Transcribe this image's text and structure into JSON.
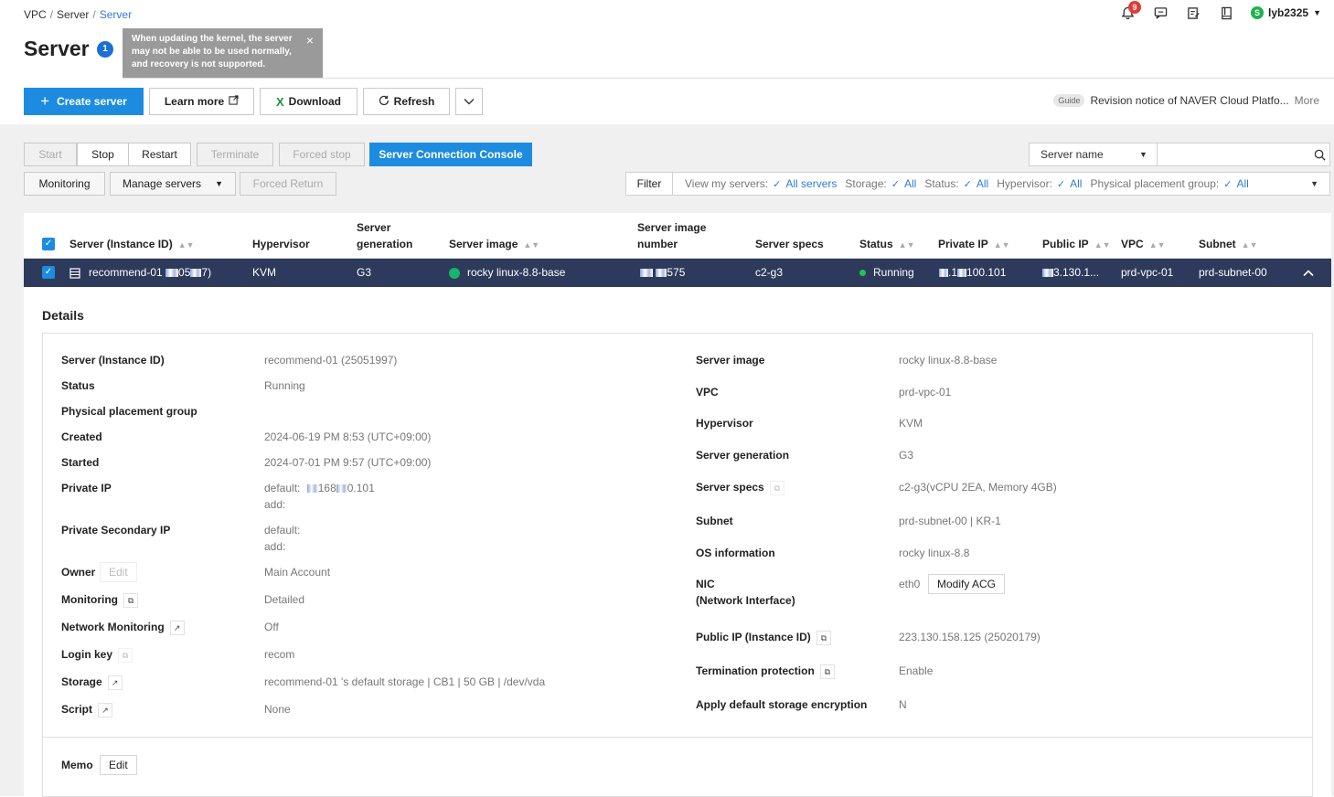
{
  "breadcrumb": {
    "items": [
      "VPC",
      "Server"
    ],
    "current": "Server"
  },
  "page": {
    "title": "Server",
    "info_badge": "1"
  },
  "tooltip": {
    "text": "When updating the kernel, the server may not be able to be used normally, and recovery is not supported.",
    "close": "×"
  },
  "header": {
    "notification_count": "9",
    "user": "lyb2325",
    "user_initial": "S"
  },
  "toolbar": {
    "create": "Create server",
    "learn": "Learn more",
    "download": "Download",
    "refresh": "Refresh"
  },
  "guide": {
    "tag": "Guide",
    "text": "Revision notice of NAVER Cloud Platfo...",
    "more": "More"
  },
  "actions": {
    "start": "Start",
    "stop": "Stop",
    "restart": "Restart",
    "terminate": "Terminate",
    "forced_stop": "Forced stop",
    "console": "Server Connection Console",
    "monitoring": "Monitoring",
    "manage": "Manage servers",
    "forced_return": "Forced Return"
  },
  "search": {
    "field": "Server name",
    "placeholder": ""
  },
  "filter": {
    "label": "Filter",
    "items": [
      {
        "label": "View my servers:",
        "value": "All servers"
      },
      {
        "label": "Storage:",
        "value": "All"
      },
      {
        "label": "Status:",
        "value": "All"
      },
      {
        "label": "Hypervisor:",
        "value": "All"
      },
      {
        "label": "Physical placement group:",
        "value": "All"
      }
    ]
  },
  "table": {
    "headers": {
      "server": "Server (Instance ID)",
      "hypervisor": "Hypervisor",
      "generation_1": "Server",
      "generation_2": "generation",
      "image": "Server image",
      "image_number_1": "Server image",
      "image_number_2": "number",
      "specs": "Server specs",
      "status": "Status",
      "private_ip": "Private IP",
      "public_ip": "Public IP",
      "vpc": "VPC",
      "subnet": "Subnet"
    },
    "row": {
      "server_prefix": "recommend-01",
      "server_mid": "05",
      "server_suffix": "7)",
      "hypervisor": "KVM",
      "generation": "G3",
      "image": "rocky linux-8.8-base",
      "image_number_suffix": "575",
      "specs": "c2-g3",
      "status": "Running",
      "private_ip_mid": ".1",
      "private_ip_suffix": "100.101",
      "public_ip_suffix": "3.130.1...",
      "vpc": "prd-vpc-01",
      "subnet": "prd-subnet-00"
    }
  },
  "details": {
    "title": "Details",
    "left": {
      "server_label": "Server (Instance ID)",
      "server_value": "recommend-01 (25051997)",
      "status_label": "Status",
      "status_value": "Running",
      "ppg_label": "Physical placement group",
      "created_label": "Created",
      "created_value": "2024-06-19 PM 8:53 (UTC+09:00)",
      "started_label": "Started",
      "started_value": "2024-07-01 PM 9:57 (UTC+09:00)",
      "private_ip_label": "Private IP",
      "private_ip_default": "default:",
      "private_ip_value_a": "168",
      "private_ip_value_b": "0.101",
      "private_ip_add": "add:",
      "secondary_label": "Private Secondary IP",
      "secondary_default": "default:",
      "secondary_add": "add:",
      "owner_label": "Owner",
      "owner_edit": "Edit",
      "owner_value": "Main Account",
      "monitoring_label": "Monitoring",
      "monitoring_value": "Detailed",
      "netmon_label": "Network Monitoring",
      "netmon_value": "Off",
      "loginkey_label": "Login key",
      "loginkey_value": "recom",
      "storage_label": "Storage",
      "storage_value": "recommend-01 's default storage | CB1 | 50 GB | /dev/vda",
      "script_label": "Script",
      "script_value": "None"
    },
    "right": {
      "image_label": "Server image",
      "image_value": "rocky linux-8.8-base",
      "vpc_label": "VPC",
      "vpc_value": "prd-vpc-01",
      "hypervisor_label": "Hypervisor",
      "hypervisor_value": "KVM",
      "generation_label": "Server generation",
      "generation_value": "G3",
      "specs_label": "Server specs",
      "specs_value": "c2-g3(vCPU 2EA, Memory 4GB)",
      "subnet_label": "Subnet",
      "subnet_value": "prd-subnet-00 | KR-1",
      "os_label": "OS information",
      "os_value": "rocky linux-8.8",
      "nic_label_1": "NIC",
      "nic_label_2": "(Network Interface)",
      "nic_value": "eth0",
      "nic_button": "Modify ACG",
      "publicip_label": "Public IP (Instance ID)",
      "publicip_value": "223.130.158.125 (25020179)",
      "termination_label": "Termination protection",
      "termination_value": "Enable",
      "encryption_label": "Apply default storage encryption",
      "encryption_value": "N"
    },
    "memo_label": "Memo",
    "memo_edit": "Edit"
  },
  "colors": {
    "primary": "#1d8ce0",
    "selected_row": "#2d3a5c",
    "running": "#20c35a",
    "link": "#2f7bd9"
  }
}
